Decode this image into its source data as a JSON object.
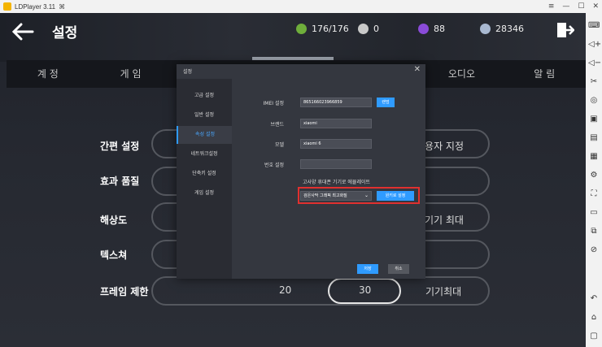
{
  "window": {
    "title": "LDPlayer 3.11",
    "controls": [
      "≡",
      "—",
      "☐",
      "✕"
    ]
  },
  "header": {
    "title": "설정",
    "resources": [
      {
        "value": "176/176",
        "icon": "stamina-icon",
        "color": "#6fae3b"
      },
      {
        "value": "0",
        "icon": "pearl-icon",
        "color": "#c9c9c9"
      },
      {
        "value": "88",
        "icon": "gem-icon",
        "color": "#8a4bd8"
      },
      {
        "value": "28346",
        "icon": "coin-icon",
        "color": "#a8b8d0"
      }
    ]
  },
  "tabs": [
    {
      "label": "계 정"
    },
    {
      "label": "게 임"
    },
    {
      "label": ""
    },
    {
      "label": ""
    },
    {
      "label": ""
    },
    {
      "label": "오디오"
    },
    {
      "label": "알 림"
    }
  ],
  "settings": {
    "labels": [
      "간편 설정",
      "효과 품질",
      "해상도",
      "텍스쳐",
      "프레임 제한"
    ],
    "simple_custom": "사용자 지정",
    "resolution_max": "기기 최대",
    "frame_options": [
      "20",
      "30",
      "기기최대"
    ]
  },
  "dialog": {
    "title": "설정",
    "close": "✕",
    "sidebar": [
      {
        "label": "고급 설정",
        "active": false
      },
      {
        "label": "일반 설정",
        "active": false
      },
      {
        "label": "속성 설정",
        "active": true
      },
      {
        "label": "네트워크설정",
        "active": false
      },
      {
        "label": "단축키 설정",
        "active": false
      },
      {
        "label": "게임 설정",
        "active": false
      }
    ],
    "fields": {
      "imei_label": "IMEI 설정",
      "imei_value": "865166023966859",
      "imei_button": "랜덤",
      "brand_label": "브랜드",
      "brand_value": "xiaomi",
      "model_label": "모델",
      "model_value": "xiaomi 6",
      "phone_label": "번호 설정",
      "phone_value": ""
    },
    "emulate_text": "고사양 휴대폰 기기로 에뮬레이트",
    "emulate_select": "검은사막 그래픽 최고화질",
    "emulate_button": "원키로 설정",
    "save": "저장",
    "cancel": "취소",
    "accent": "#2f9bff",
    "highlight_color": "#e0302f"
  },
  "toolbar": [
    "keyboard-icon",
    "volume-up-icon",
    "volume-down-icon",
    "scissors-icon",
    "location-icon",
    "screenshot-icon",
    "record-icon",
    "apk-icon",
    "settings-icon",
    "fullscreen-icon",
    "shake-icon",
    "multi-icon",
    "shortcut-icon",
    "back-icon",
    "home-icon",
    "recent-icon"
  ]
}
